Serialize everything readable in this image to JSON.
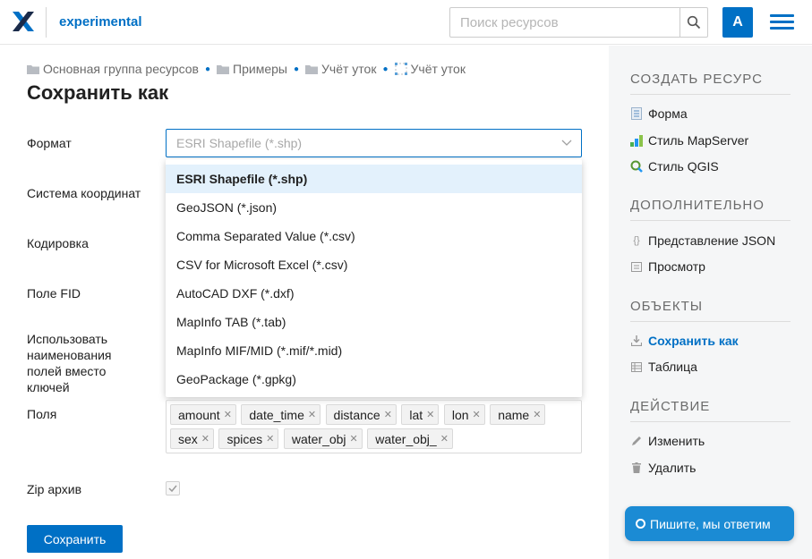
{
  "header": {
    "app_name": "experimental",
    "search_placeholder": "Поиск ресурсов",
    "avatar_letter": "A"
  },
  "breadcrumb": [
    {
      "label": "Основная группа ресурсов",
      "icon": "folder-icon"
    },
    {
      "label": "Примеры",
      "icon": "folder-icon"
    },
    {
      "label": "Учёт уток",
      "icon": "folder-icon"
    },
    {
      "label": "Учёт уток",
      "icon": "vector-layer-icon"
    }
  ],
  "page_title": "Сохранить как",
  "form": {
    "format_label": "Формат",
    "format_value": "ESRI Shapefile (*.shp)",
    "crs_label": "Система координат",
    "encoding_label": "Кодировка",
    "fid_label": "Поле FID",
    "use_names_label": "Использовать наименования полей вместо ключей",
    "fields_label": "Поля",
    "zip_label": "Zip архив",
    "zip_checked": true,
    "save_button": "Сохранить"
  },
  "format_options": [
    "ESRI Shapefile (*.shp)",
    "GeoJSON (*.json)",
    "Comma Separated Value (*.csv)",
    "CSV for Microsoft Excel (*.csv)",
    "AutoCAD DXF (*.dxf)",
    "MapInfo TAB (*.tab)",
    "MapInfo MIF/MID (*.mif/*.mid)",
    "GeoPackage (*.gpkg)"
  ],
  "selected_format_index": 0,
  "fields_tags": [
    "amount",
    "date_time",
    "distance",
    "lat",
    "lon",
    "name",
    "sex",
    "spices",
    "water_obj",
    "water_obj_"
  ],
  "sidebar": {
    "sections": [
      {
        "title": "СОЗДАТЬ РЕСУРС",
        "items": [
          {
            "label": "Форма",
            "icon": "form-icon"
          },
          {
            "label": "Стиль MapServer",
            "icon": "mapserver-style-icon"
          },
          {
            "label": "Стиль QGIS",
            "icon": "qgis-style-icon"
          }
        ]
      },
      {
        "title": "ДОПОЛНИТЕЛЬНО",
        "items": [
          {
            "label": "Представление JSON",
            "icon": "json-icon"
          },
          {
            "label": "Просмотр",
            "icon": "preview-icon"
          }
        ]
      },
      {
        "title": "ОБЪЕКТЫ",
        "items": [
          {
            "label": "Сохранить как",
            "icon": "download-icon",
            "active": true
          },
          {
            "label": "Таблица",
            "icon": "table-icon"
          }
        ]
      },
      {
        "title": "ДЕЙСТВИЕ",
        "items": [
          {
            "label": "Изменить",
            "icon": "pencil-icon"
          },
          {
            "label": "Удалить",
            "icon": "trash-icon"
          }
        ]
      }
    ]
  },
  "chat_button": "Пишите, мы ответим",
  "colors": {
    "accent": "#0070c5",
    "sidebar_bg": "#f5f6f7",
    "selected_option_bg": "#e3f1fc",
    "chat_bg": "#1b8bd4"
  }
}
